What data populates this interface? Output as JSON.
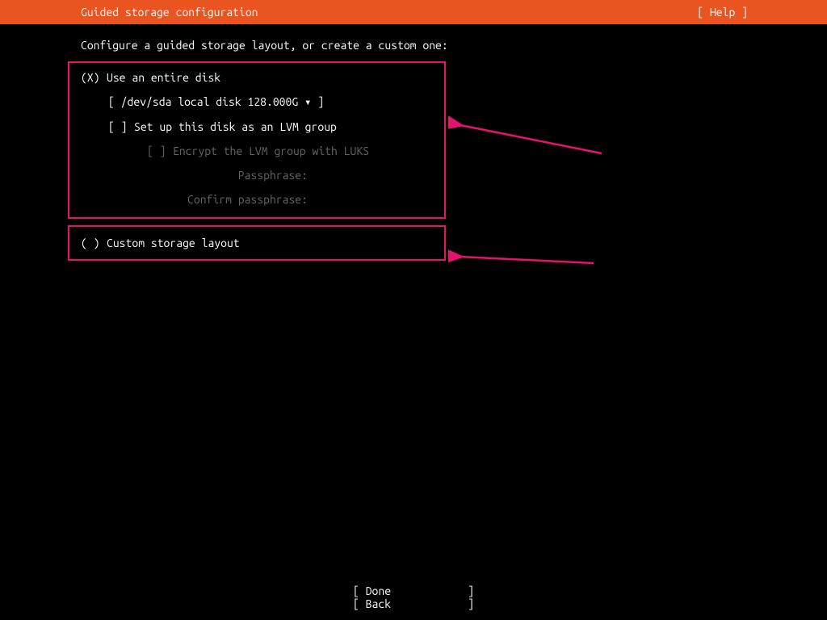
{
  "header": {
    "title": "Guided storage configuration",
    "help": "[ Help ]"
  },
  "instruction": "Configure a guided storage layout, or create a custom one:",
  "option1": {
    "radio": "(X)",
    "label": "Use an entire disk",
    "disk_open": "[",
    "disk_value": " /dev/sda local disk 128.000G ",
    "disk_arrow": "▾",
    "disk_close": " ]",
    "lvm_check": "[ ]",
    "lvm_label": "Set up this disk as an LVM group",
    "luks_check": "[ ]",
    "luks_label": "Encrypt the LVM group with LUKS",
    "passphrase_label": "Passphrase:",
    "confirm_label": "Confirm passphrase:"
  },
  "option2": {
    "radio": "( )",
    "label": "Custom storage layout"
  },
  "footer": {
    "done": "Done",
    "back": "Back"
  },
  "annotation": {
    "arrow_color": "#e6126f"
  }
}
